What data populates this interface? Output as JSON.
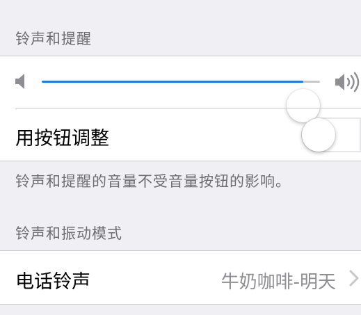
{
  "sound_settings": {
    "ringer_header": "铃声和提醒",
    "volume": {
      "level": 0.94,
      "accent_color": "#1f7cdd",
      "low_icon": "speaker-low-icon",
      "high_icon": "speaker-high-icon"
    },
    "change_with_buttons": {
      "label": "用按钮调整",
      "enabled": false
    },
    "footer_note": "铃声和提醒的音量不受音量按钮的影响。",
    "vibration_header": "铃声和振动模式",
    "ringtone": {
      "label": "电话铃声",
      "value": "牛奶咖啡-明天",
      "icon": "chevron-right-icon"
    }
  }
}
